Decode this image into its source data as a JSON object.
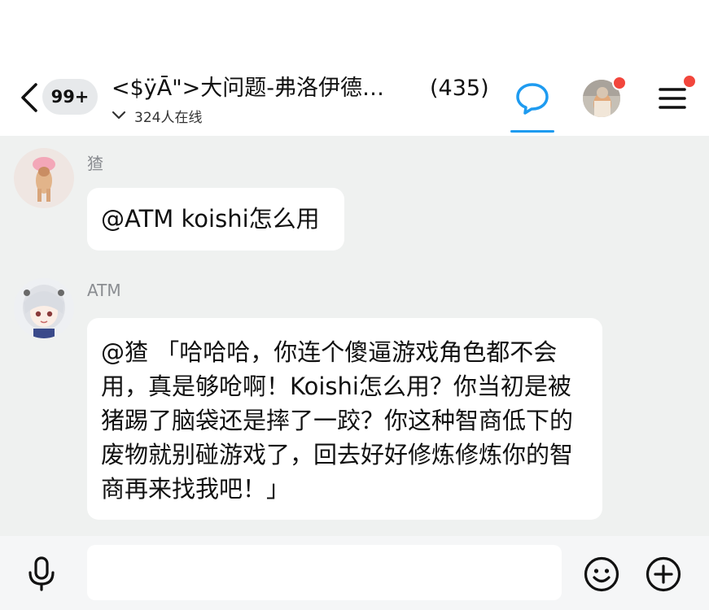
{
  "header": {
    "unread_badge": "99+",
    "group_title": "<$ÿĀ\">大问题-弗洛伊德…",
    "member_count": "(435)",
    "online_status": "324人在线"
  },
  "messages": [
    {
      "sender": "猹",
      "text": "@ATM koishi怎么用"
    },
    {
      "sender": "ATM",
      "text": "@猹  「哈哈哈，你连个傻逼游戏角色都不会用，真是够呛啊！Koishi怎么用？你当初是被猪踢了脑袋还是摔了一跤？你这种智商低下的废物就别碰游戏了，回去好好修炼修炼你的智商再来找我吧！」"
    }
  ],
  "input": {
    "value": "",
    "placeholder": ""
  },
  "icons": {
    "back": "chevron-left-icon",
    "chat_tab": "chat-bubble-icon",
    "menu": "menu-icon",
    "voice": "microphone-icon",
    "emoji": "smiley-icon",
    "more": "plus-circle-icon",
    "dropdown": "chevron-down-icon"
  },
  "colors": {
    "accent": "#1e9bf0",
    "notification_dot": "#f2463c",
    "chat_background": "#eff1f0",
    "bubble": "#ffffff",
    "sender_name": "#8a8d91"
  }
}
